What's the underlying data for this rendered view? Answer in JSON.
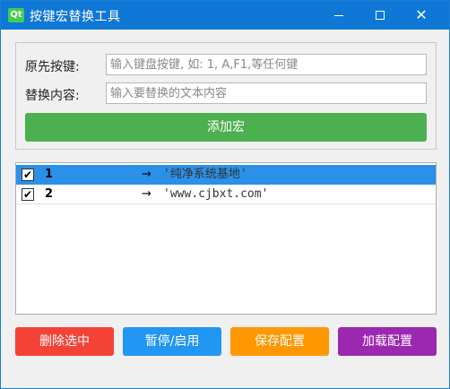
{
  "window": {
    "title": "按键宏替换工具",
    "logo_text": "Qt",
    "close_glyph": "✕"
  },
  "form": {
    "key_label": "原先按键:",
    "key_placeholder": "输入键盘按键, 如: 1, A,F1,等任何键",
    "text_label": "替换内容:",
    "text_placeholder": "输入要替换的文本内容",
    "add_button": "添加宏"
  },
  "macros": [
    {
      "checked": true,
      "check_glyph": "✔",
      "key": "1",
      "arrow": "→",
      "text": "'纯净系统基地'",
      "selected": true
    },
    {
      "checked": true,
      "check_glyph": "✔",
      "key": "2",
      "arrow": "→",
      "text": "'www.cjbxt.com'",
      "selected": false
    }
  ],
  "actions": {
    "delete": "删除选中",
    "toggle": "暂停/启用",
    "save": "保存配置",
    "load": "加载配置"
  },
  "colors": {
    "titlebar": "#0f78d7",
    "add": "#4caf50",
    "delete": "#f44336",
    "toggle": "#2196f3",
    "save": "#ff9800",
    "load": "#9c27b0",
    "selection": "#2b90e8"
  }
}
